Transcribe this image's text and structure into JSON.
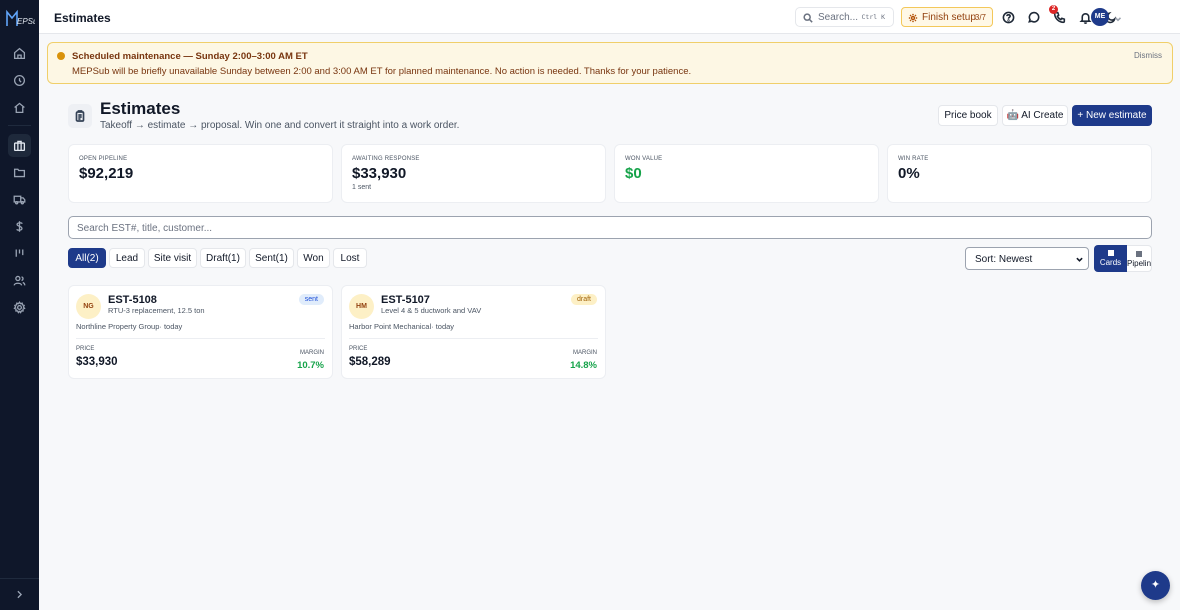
{
  "app": {
    "logo_text": "MEPSub"
  },
  "topbar": {
    "title": "Estimates",
    "search": {
      "placeholder": "Search...",
      "shortcut": "Ctrl K"
    },
    "finish_setup": {
      "label": "Finish setup",
      "progress": "3/7"
    },
    "notifications_count": "2",
    "user_initials": "ME"
  },
  "banner": {
    "title": "Scheduled maintenance — Sunday 2:00–3:00 AM ET",
    "message": "MEPSub will be briefly unavailable Sunday between 2:00 and 3:00 AM ET for planned maintenance. No action is needed. Thanks for your patience.",
    "dismiss": "Dismiss",
    "accent": "#d9920a"
  },
  "header": {
    "title": "Estimates",
    "subtitle": "Takeoff → estimate → proposal. Win one and convert it straight into a work order.",
    "price_book": "Price book",
    "ai_create": "🤖 AI Create",
    "new_estimate": "+ New estimate"
  },
  "stats": [
    {
      "label": "OPEN PIPELINE",
      "value": "$92,219",
      "sub": ""
    },
    {
      "label": "AWAITING RESPONSE",
      "value": "$33,930",
      "sub": "1 sent"
    },
    {
      "label": "WON VALUE",
      "value": "$0",
      "sub": ""
    },
    {
      "label": "WIN RATE",
      "value": "0%",
      "sub": ""
    }
  ],
  "list_search": {
    "placeholder": "Search EST#, title, customer..."
  },
  "filters": [
    "All(2)",
    "Lead",
    "Site visit",
    "Draft(1)",
    "Sent(1)",
    "Won",
    "Lost"
  ],
  "active_filter": "All(2)",
  "sort": {
    "value": "Sort: Newest"
  },
  "views": {
    "cards": "Cards",
    "pipeline": "Pipeline",
    "active": "Cards"
  },
  "estimates": [
    {
      "initials": "NG",
      "number": "EST-5108",
      "description": "RTU-3 replacement, 12.5 ton",
      "status": "sent",
      "customer": "Northline Property Group· today",
      "price_label": "PRICE",
      "price": "$33,930",
      "margin_label": "MARGIN",
      "margin": "10.7%"
    },
    {
      "initials": "HM",
      "number": "EST-5107",
      "description": "Level 4 & 5 ductwork and VAV",
      "status": "draft",
      "customer": "Harbor Point Mechanical· today",
      "price_label": "PRICE",
      "price": "$58,289",
      "margin_label": "MARGIN",
      "margin": "14.8%"
    }
  ],
  "fab": {
    "icon": "sparkle-icon",
    "glyph": "✦"
  },
  "colors": {
    "primary": "#1e3a8a",
    "sidebar": "#0f172a",
    "positive": "#16a34a"
  }
}
